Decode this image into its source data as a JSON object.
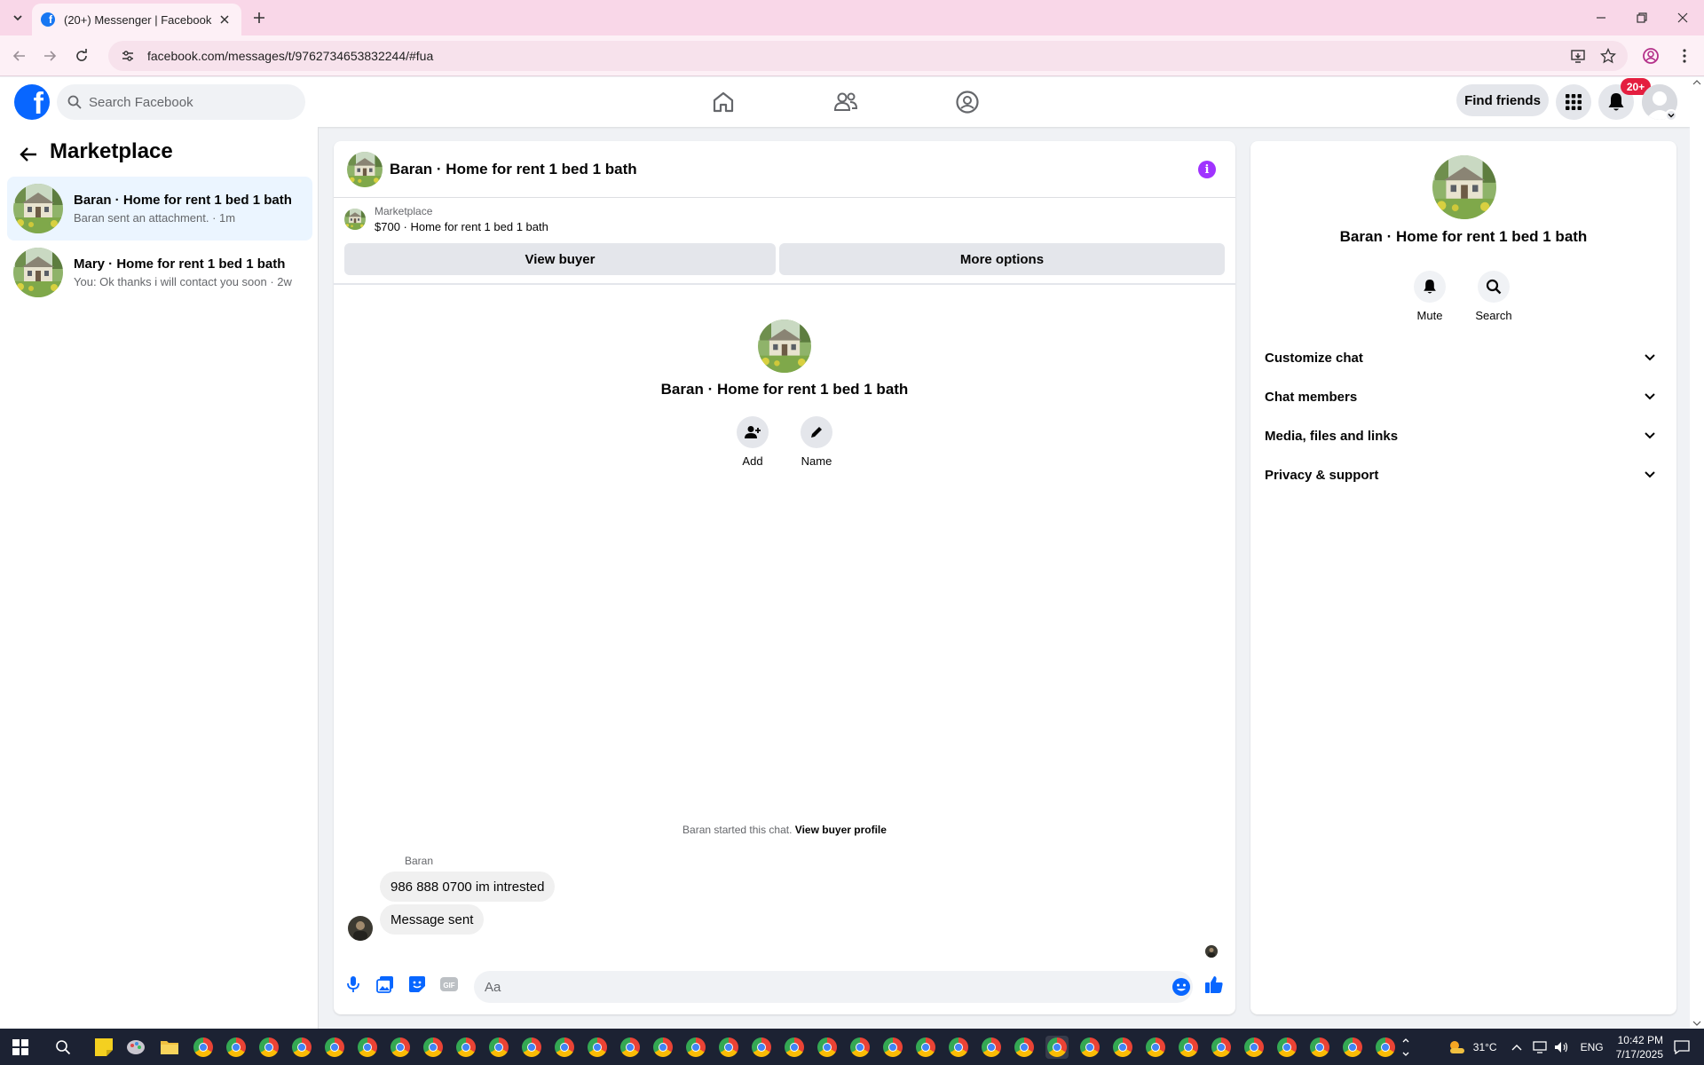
{
  "browser": {
    "tab_title": "(20+) Messenger | Facebook",
    "url": "facebook.com/messages/t/9762734653832244/#fua"
  },
  "header": {
    "search_placeholder": "Search Facebook",
    "find_friends": "Find friends",
    "notification_badge": "20+",
    "brand_color": "#0866ff"
  },
  "sidebar": {
    "title": "Marketplace",
    "conversations": [
      {
        "name": "Baran · Home for rent 1 bed 1 bath",
        "preview": "Baran sent an attachment. · 1m",
        "active": true
      },
      {
        "name": "Mary · Home for rent 1 bed 1 bath",
        "preview": "You: Ok thanks i will contact you soon · 2w",
        "active": false
      }
    ]
  },
  "chat": {
    "title": "Baran · Home for rent 1 bed 1 bath",
    "listing_source": "Marketplace",
    "listing_title": "$700 · Home for rent 1 bed 1 bath",
    "view_buyer": "View buyer",
    "more_options": "More options",
    "intro_name": "Baran · Home for rent 1 bed 1 bath",
    "add_label": "Add",
    "name_label": "Name",
    "started_text": "Baran started this chat.",
    "view_buyer_profile": "View buyer profile",
    "sender_name": "Baran",
    "messages": [
      {
        "text": "986 888 0700 im intrested"
      },
      {
        "text": "Message sent"
      }
    ],
    "composer_placeholder": "Aa",
    "accent_color": "#0866ff"
  },
  "details": {
    "name": "Baran · Home for rent 1 bed 1 bath",
    "mute": "Mute",
    "search": "Search",
    "sections": [
      "Customize chat",
      "Chat members",
      "Media, files and links",
      "Privacy & support"
    ]
  },
  "taskbar": {
    "weather": "31°C",
    "language": "ENG",
    "time": "10:42 PM",
    "date": "7/17/2025"
  }
}
